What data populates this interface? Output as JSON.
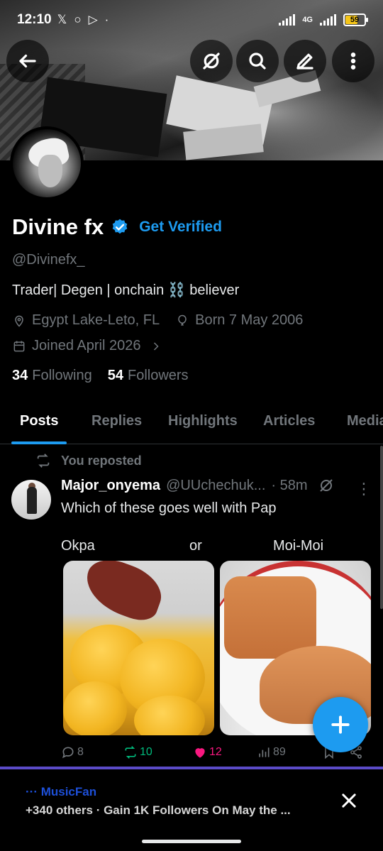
{
  "status_bar": {
    "time": "12:10",
    "network": "4G",
    "battery": "59",
    "colors": {
      "battery": "#f5c518"
    }
  },
  "top_nav": {
    "icons": [
      "back-arrow-icon",
      "grok-icon",
      "search-icon",
      "edit-icon",
      "more-icon"
    ]
  },
  "profile": {
    "name": "Divine fx",
    "get_verified": "Get Verified",
    "handle": "@Divinefx_",
    "bio": "Trader| Degen | onchain ⛓️ believer",
    "location": "Egypt Lake-Leto, FL",
    "born": "Born 7 May 2006",
    "joined": "Joined April 2026",
    "following_count": "34",
    "following_label": "Following",
    "followers_count": "54",
    "followers_label": "Followers"
  },
  "tabs": [
    {
      "label": "Posts",
      "active": true
    },
    {
      "label": "Replies"
    },
    {
      "label": "Highlights"
    },
    {
      "label": "Articles"
    },
    {
      "label": "Media"
    }
  ],
  "post": {
    "repost_label": "You reposted",
    "author": "Major_onyema",
    "handle": "@UUchechuk...",
    "time": "· 58m",
    "text": "Which of these goes well with Pap",
    "option_left": "Okpa",
    "option_mid": "or",
    "option_right": "Moi-Moi",
    "replies": "8",
    "reposts": "10",
    "likes": "12",
    "views": "89"
  },
  "notification": {
    "app": "··· MusicFan",
    "text": "+340 others · Gain 1K Followers On May the ..."
  },
  "colors": {
    "accent": "#1d9bf0",
    "repost_green": "#00ba7c",
    "like_pink": "#f91880",
    "secondary_text": "#71767b"
  }
}
